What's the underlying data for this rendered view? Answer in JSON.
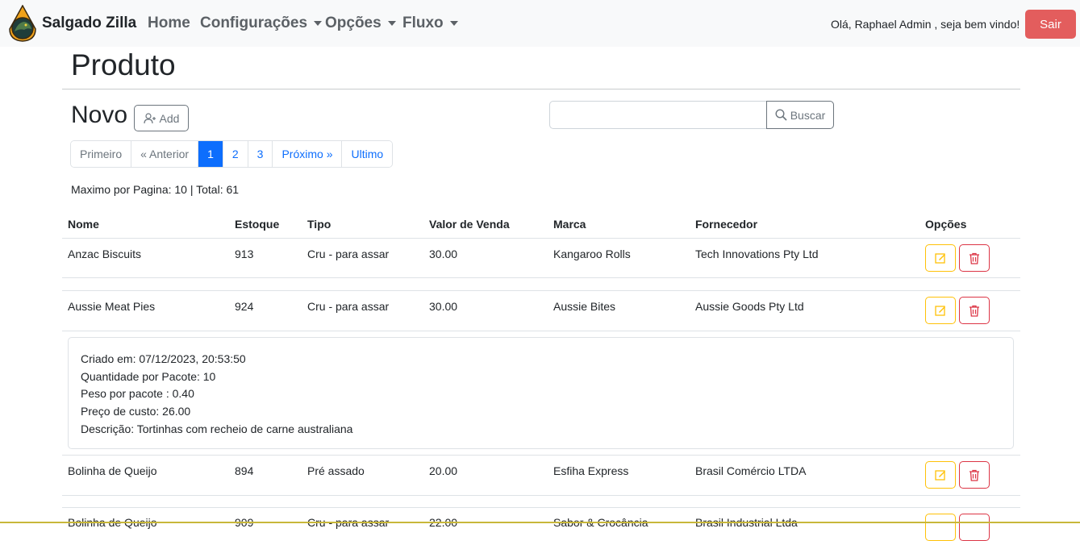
{
  "navbar": {
    "brand": "Salgado Zilla",
    "items": [
      {
        "label": "Home",
        "dropdown": false
      },
      {
        "label": "Configurações",
        "dropdown": true
      },
      {
        "label": "Opções",
        "dropdown": true
      },
      {
        "label": "Fluxo",
        "dropdown": true
      }
    ],
    "greeting": "Olá, Raphael Admin , seja bem vindo!",
    "logout_label": "Sair"
  },
  "page": {
    "title": "Produto",
    "new_label": "Novo",
    "add_label": "Add",
    "search_placeholder": "",
    "search_label": "Buscar"
  },
  "pagination": {
    "first": "Primeiro",
    "prev": "« Anterior",
    "pages": [
      "1",
      "2",
      "3"
    ],
    "current": "1",
    "next": "Próximo »",
    "last": "Ultimo"
  },
  "meta": "Maximo por Pagina: 10 | Total: 61",
  "table": {
    "headers": [
      "Nome",
      "Estoque",
      "Tipo",
      "Valor de Venda",
      "Marca",
      "Fornecedor",
      "Opções"
    ],
    "rows": [
      {
        "nome": "Anzac Biscuits",
        "estoque": "913",
        "tipo": "Cru - para assar",
        "valor": "30.00",
        "marca": "Kangaroo Rolls",
        "fornecedor": "Tech Innovations Pty Ltd"
      },
      {
        "nome": "Aussie Meat Pies",
        "estoque": "924",
        "tipo": "Cru - para assar",
        "valor": "30.00",
        "marca": "Aussie Bites",
        "fornecedor": "Aussie Goods Pty Ltd"
      },
      {
        "nome": "Bolinha de Queijo",
        "estoque": "894",
        "tipo": "Pré assado",
        "valor": "20.00",
        "marca": "Esfiha Express",
        "fornecedor": "Brasil Comércio LTDA"
      },
      {
        "nome": "Bolinha de Queijo",
        "estoque": "909",
        "tipo": "Cru - para assar",
        "valor": "22.00",
        "marca": "Sabor & Crocância",
        "fornecedor": "Brasil Industrial Ltda"
      }
    ],
    "details": [
      "Criado em: 07/12/2023, 20:53:50",
      "Quantidade por Pacote: 10",
      "Peso por pacote : 0.40",
      "Preço de custo: 26.00",
      "Descrição: Tortinhas com recheio de carne australiana"
    ]
  },
  "colors": {
    "primary": "#0d6efd",
    "danger": "#dc3545",
    "warning": "#ffc107",
    "logout_bg": "#e35d5d"
  }
}
